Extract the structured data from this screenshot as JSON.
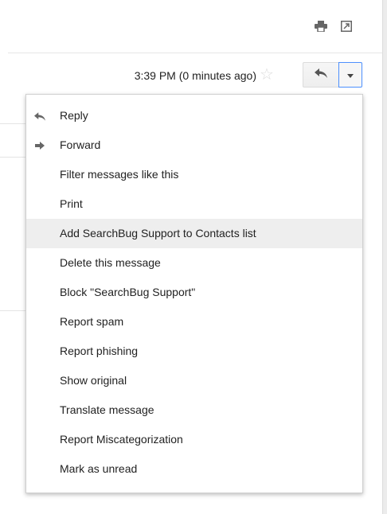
{
  "header": {
    "timestamp": "3:39 PM (0 minutes ago)",
    "icons": [
      "print-icon",
      "new-window-icon",
      "star-icon",
      "reply-icon",
      "dropdown-arrow-icon"
    ]
  },
  "menu": {
    "items": [
      {
        "label": "Reply",
        "icon": "reply-icon"
      },
      {
        "label": "Forward",
        "icon": "forward-icon"
      },
      {
        "label": "Filter messages like this"
      },
      {
        "label": "Print"
      },
      {
        "label": "Add SearchBug Support to Contacts list",
        "highlighted": true
      },
      {
        "label": "Delete this message"
      },
      {
        "label": "Block \"SearchBug Support\""
      },
      {
        "label": "Report spam"
      },
      {
        "label": "Report phishing"
      },
      {
        "label": "Show original"
      },
      {
        "label": "Translate message"
      },
      {
        "label": "Report Miscategorization"
      },
      {
        "label": "Mark as unread"
      }
    ]
  },
  "colors": {
    "highlight_bg": "#eeeeee",
    "focus_border": "#4d90fe",
    "text": "#222222",
    "icon": "#666666"
  }
}
